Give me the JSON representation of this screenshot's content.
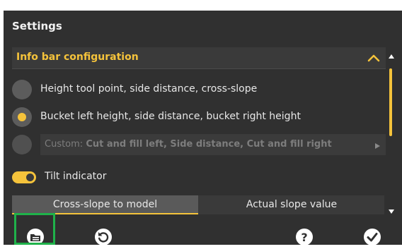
{
  "header": {
    "title": "Settings"
  },
  "section": {
    "title": "Info bar configuration",
    "chevron_icon": "chevron-up-icon"
  },
  "options": [
    {
      "label": "Height tool point, side distance, cross-slope",
      "selected": false
    },
    {
      "label": "Bucket left height, side distance, bucket right height",
      "selected": true
    },
    {
      "prefix": "Custom: ",
      "value": "Cut and fill left, Side distance, Cut and fill right",
      "selected": false,
      "disabled": true
    }
  ],
  "tilt": {
    "label": "Tilt indicator",
    "enabled": true
  },
  "segmented": {
    "options": [
      "Cross-slope to model",
      "Actual slope value"
    ],
    "selected": 0
  },
  "toolbar": {
    "icons": [
      "folder-icon",
      "reset-icon",
      "help-icon",
      "confirm-icon"
    ]
  },
  "colors": {
    "accent": "#f5c33b",
    "panel": "#303030",
    "focus": "#1fb24a"
  }
}
